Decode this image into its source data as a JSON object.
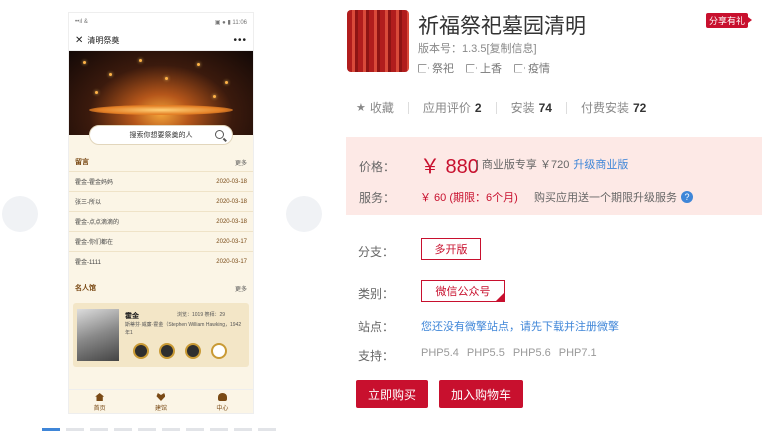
{
  "phone": {
    "status_left": "••ıl &",
    "status_right": "▣ ● ▮ 11:06",
    "close_label": "✕",
    "title": "清明祭奠",
    "more_label": "•••",
    "search_placeholder": "搜索你想要祭奠的人",
    "messages_title": "留言",
    "messages_more": "更多",
    "messages": [
      {
        "text": "霍金-霍金妈妈",
        "date": "2020-03-18"
      },
      {
        "text": "张三-所以",
        "date": "2020-03-18"
      },
      {
        "text": "霍金-点点滴滴的",
        "date": "2020-03-18"
      },
      {
        "text": "霍金-你们都在",
        "date": "2020-03-17"
      },
      {
        "text": "霍金-1111",
        "date": "2020-03-17"
      }
    ],
    "celebs_title": "名人馆",
    "celebs_more": "更多",
    "celeb": {
      "name": "霍金",
      "stats": "浏览：1019  祭拜：29",
      "bio": "斯蒂芬·威廉·霍金（Stephen William Hawking，1942年1"
    },
    "tabs": [
      {
        "label": "首页",
        "icon": "home-icon"
      },
      {
        "label": "建馆",
        "icon": "heart-icon"
      },
      {
        "label": "中心",
        "icon": "user-icon"
      }
    ]
  },
  "app": {
    "title": "祈福祭祀墓园清明",
    "share_label": "分享有礼",
    "version": "版本号：1.3.5[复制信息]",
    "tags": [
      "祭祀",
      "上香",
      "疫情"
    ],
    "favorite_label": "收藏",
    "rating_label": "应用评价",
    "rating_count": "2",
    "install_label": "安装",
    "install_count": "74",
    "paid_install_label": "付费安装",
    "paid_install_count": "72"
  },
  "price": {
    "label": "价格：",
    "main": "￥ 880",
    "sub": "| 商业版专享 ￥720",
    "upgrade": "升级商业版",
    "service_label": "服务：",
    "service_value": "￥ 60 (期限：6个月)",
    "service_note": "购买应用送一个期限升级服务",
    "help_glyph": "?"
  },
  "options": {
    "branch_label": "分支：",
    "branch_value": "多开版",
    "category_label": "类别：",
    "category_value": "微信公众号",
    "site_label": "站点：",
    "site_text": "您还没有微擎站点，请先下载并注册微擎",
    "support_label": "支持：",
    "php": [
      "PHP5.4",
      "PHP5.5",
      "PHP5.6",
      "PHP7.1"
    ]
  },
  "actions": {
    "buy_now": "立即购买",
    "add_cart": "加入购物车"
  },
  "colors": {
    "accent_red": "#c8102e",
    "link_blue": "#3f86d8",
    "price_bg": "#fde9e6"
  }
}
